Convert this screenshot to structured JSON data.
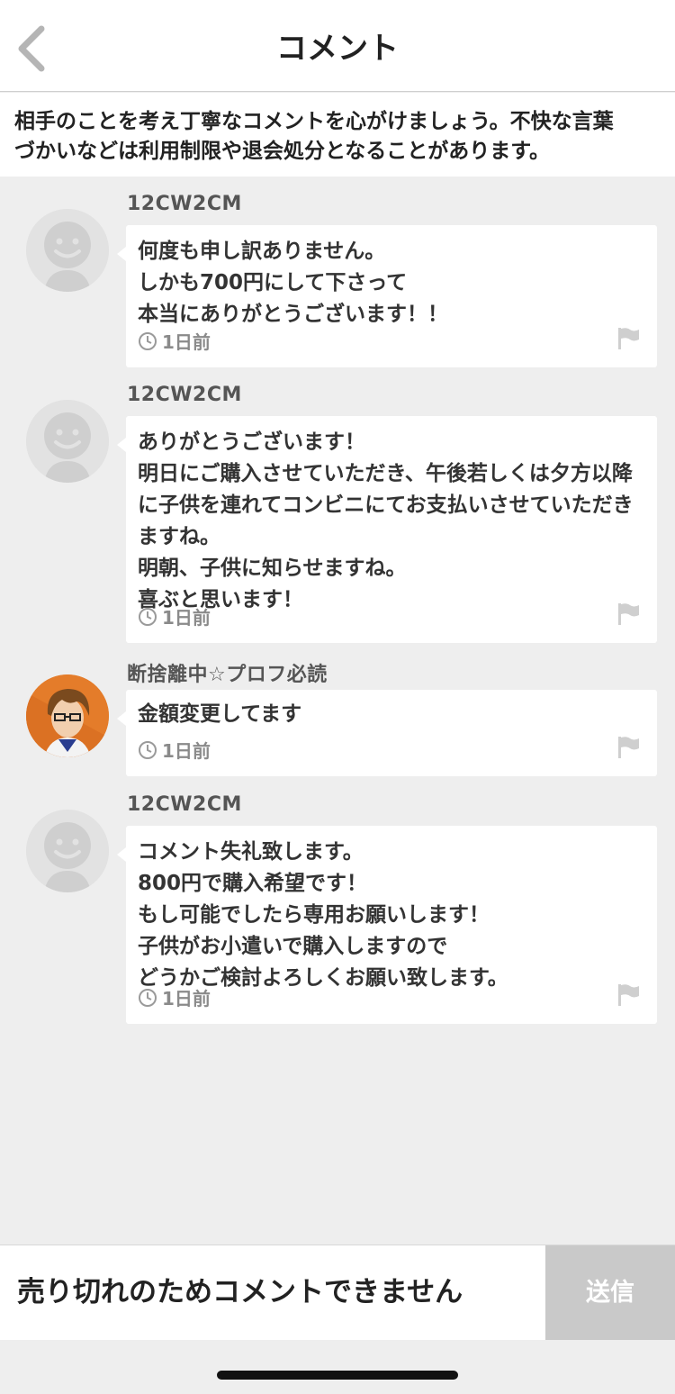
{
  "header": {
    "title": "コメント"
  },
  "notice": {
    "line1": "相手のことを考え丁寧なコメントを心がけましょう。不快な言葉",
    "line2_prefix": "づかいなどは",
    "line2_strong1": "利用制限",
    "line2_mid": "や",
    "line2_strong2": "退会処分",
    "line2_suffix": "となることがあります。"
  },
  "comments": [
    {
      "user": "12CW2CM",
      "text": "何度も申し訳ありません。\nしかも700円にして下さって\n本当にありがとうございます！！",
      "time": "1日前",
      "avatar": "default-avatar-icon"
    },
    {
      "user": "12CW2CM",
      "text": "ありがとうございます！\n明日にご購入させていただき、午後若しくは夕方以降に子供を連れてコンビニにてお支払いさせていただきますね。\n明朝、子供に知らせますね。\n喜ぶと思います！",
      "time": "1日前",
      "avatar": "default-avatar-icon"
    },
    {
      "user": "断捨離中☆プロフ必読",
      "text": "金額変更してます",
      "time": "1日前",
      "avatar": "seller-avatar"
    },
    {
      "user": "12CW2CM",
      "text": "コメント失礼致します。\n800円で購入希望です！\nもし可能でしたら専用お願いします！\n子供がお小遣いで購入しますので\nどうかご検討よろしくお願い致します。",
      "time": "1日前",
      "avatar": "default-avatar-icon"
    }
  ],
  "footer": {
    "status_text": "売り切れのためコメントできません",
    "send_label": "送信"
  },
  "colors": {
    "background": "#eeeeee",
    "send_disabled": "#c9c9c9",
    "text": "#333333"
  }
}
